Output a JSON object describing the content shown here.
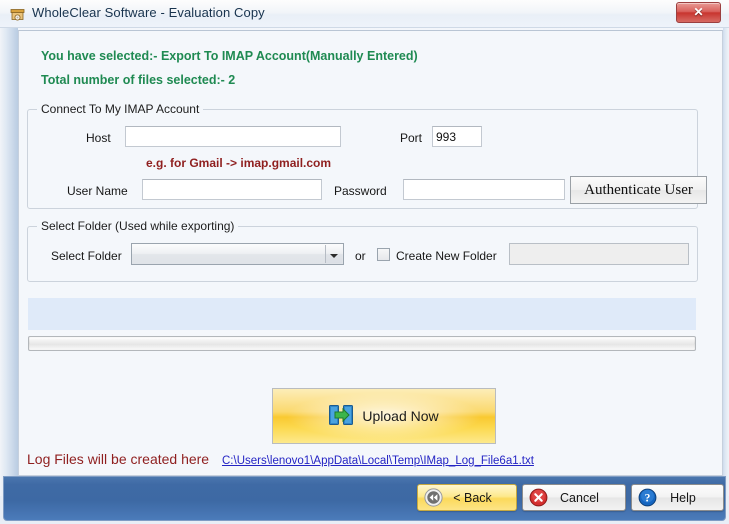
{
  "window": {
    "title": "WholeClear Software - Evaluation Copy",
    "icon": "app-box-icon",
    "close_glyph": "✕"
  },
  "status": {
    "selected_line": "You have selected:- Export  To  IMAP  Account(Manually Entered)",
    "count_line": "Total number of files selected:- 2",
    "color": "#1f8a52"
  },
  "imap_group": {
    "legend": "Connect To My IMAP Account",
    "host_label": "Host",
    "host_value": "",
    "host_placeholder": "",
    "port_label": "Port",
    "port_value": "993",
    "hint": "e.g. for Gmail -> imap.gmail.com",
    "hint_color": "#8f1f1f",
    "username_label": "User Name",
    "username_value": "",
    "password_label": "Password",
    "password_value": "",
    "authenticate_label": "Authenticate User"
  },
  "folder_group": {
    "legend": "Select Folder (Used while exporting)",
    "select_label": "Select Folder",
    "combo_value": "",
    "or_label": "or",
    "create_new_label": "Create New Folder",
    "create_new_checked": false,
    "new_folder_value": ""
  },
  "progress": {
    "value": 0,
    "list_items": []
  },
  "upload": {
    "label": "Upload Now",
    "icon": "upload-transfer-icon",
    "accent": "#f9c931"
  },
  "log": {
    "label": "Log Files will be created here",
    "path": "C:\\Users\\lenovo1\\AppData\\Local\\Temp\\IMap_Log_File6a1.txt",
    "label_color": "#8f1f1f",
    "link_color": "#2424c4"
  },
  "footer": {
    "back_label": "< Back",
    "back_icon": "rewind-icon",
    "cancel_label": "Cancel",
    "cancel_icon": "cancel-x-icon",
    "help_label": "Help",
    "help_icon": "help-question-icon",
    "bar_color": "#3d69a4"
  }
}
